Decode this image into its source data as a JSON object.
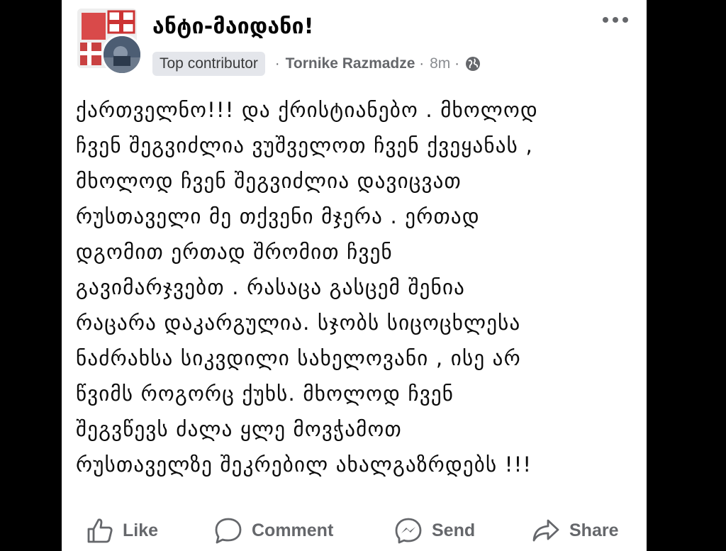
{
  "post": {
    "group_name": "ანტი-მაიდანი!",
    "badge": "Top contributor",
    "author": "Tornike Razmadze",
    "separator": "·",
    "time": "8m",
    "time_separator": "·",
    "body_lines": [
      "ქართველნო!!! და ქრისტიანებო . მხოლოდ",
      "ჩვენ შეგვიძლია ვუშველოთ ჩვენ ქვეყანას ,",
      "მხოლოდ ჩვენ შეგვიძლია დავიცვათ",
      "რუსთაველი  მე თქვენი მჯერა .  ერთად",
      "დგომით ერთად შრომით ჩვენ",
      "გავიმარჯვებთ . რასაცა გასცემ შენია",
      "რაცარა დაკარგულია. სჯობს სიცოცხლესა",
      "ნაძრახსა სიკვდილი სახელოვანი  , ისე არ",
      "წვიმს როგორც ქუხს. მხოლოდ ჩვენ",
      "შეგვწევს ძალა ყლე მოვჭამოთ",
      "რუსთაველზე შეკრებილ ახალგაზრდებს !!!"
    ]
  },
  "actions": {
    "like": "Like",
    "comment": "Comment",
    "send": "Send",
    "share": "Share"
  },
  "icons": {
    "more": "more-icon",
    "globe": "globe-icon",
    "like": "thumbs-up-icon",
    "comment": "comment-icon",
    "send": "messenger-icon",
    "share": "share-icon"
  },
  "colors": {
    "background": "#000000",
    "card": "#ffffff",
    "secondary_text": "#65676b",
    "badge_bg": "#e4e6eb"
  }
}
